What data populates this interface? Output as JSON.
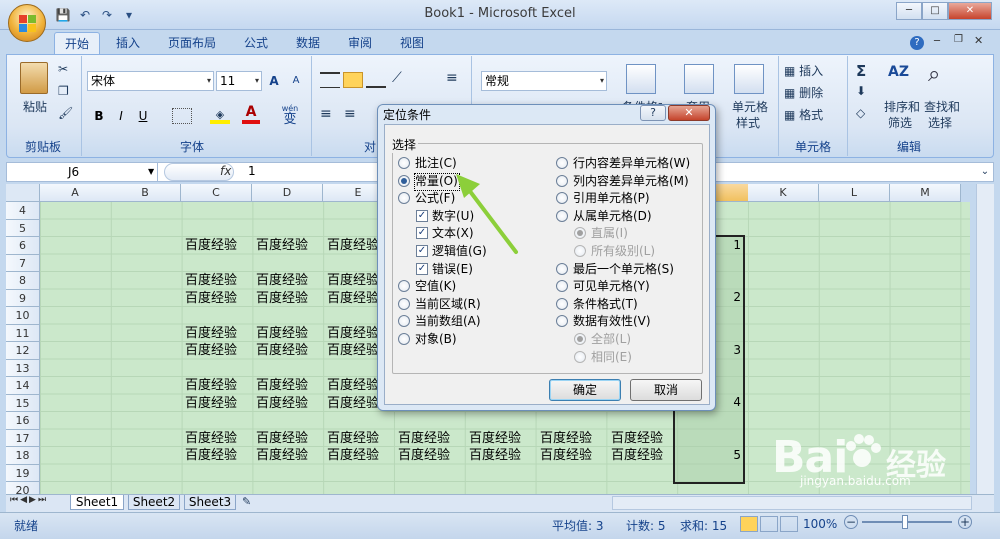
{
  "window": {
    "title": "Book1 - Microsoft Excel",
    "minimize": "─",
    "restore": "□",
    "close": "✕"
  },
  "qat": [
    "💾",
    "↶",
    "↷",
    "▾"
  ],
  "ribbon_tabs": [
    "开始",
    "插入",
    "页面布局",
    "公式",
    "数据",
    "审阅",
    "视图"
  ],
  "ribbon": {
    "clipboard": {
      "paste": "粘贴",
      "label": "剪贴板"
    },
    "font": {
      "name": "宋体",
      "size": "11",
      "grow": "A",
      "shrink": "A",
      "bold": "B",
      "italic": "I",
      "underline": "U",
      "wen": "wén",
      "wen2": "变",
      "label": "字体"
    },
    "alignment": {
      "label": "对齐方式"
    },
    "number": {
      "format": "常规"
    },
    "styles": {
      "cond": "条件格式",
      "table": "套用"
    },
    "cells": {
      "insert": "插入",
      "delete": "删除",
      "format": "格式",
      "label": "单元格",
      "cellstyle": "单元格",
      "cellstyle2": "样式"
    },
    "editing": {
      "sum": "Σ",
      "sort": "排序和",
      "sort2": "筛选",
      "find": "查找和",
      "find2": "选择",
      "label": "编辑"
    }
  },
  "formula_bar": {
    "name_box": "J6",
    "fx": "fx",
    "value": "1"
  },
  "columns": [
    "A",
    "B",
    "C",
    "D",
    "E",
    "F",
    "G",
    "H",
    "I",
    "J",
    "K",
    "L",
    "M"
  ],
  "rows": [
    "4",
    "5",
    "6",
    "7",
    "8",
    "9",
    "10",
    "11",
    "12",
    "13",
    "14",
    "15",
    "16",
    "17",
    "18",
    "19",
    "20"
  ],
  "cell_text": "百度经验",
  "j_values": [
    "1",
    "2",
    "3",
    "4",
    "5"
  ],
  "sheets": [
    "Sheet1",
    "Sheet2",
    "Sheet3"
  ],
  "status": {
    "ready": "就绪",
    "average": "平均值: 3",
    "count": "计数: 5",
    "sum": "求和: 15",
    "zoom": "100%"
  },
  "dialog": {
    "title": "定位条件",
    "help": "?",
    "close": "✕",
    "group": "选择",
    "left": [
      {
        "label": "批注(C)",
        "type": "radio",
        "checked": false
      },
      {
        "label": "常量(O)",
        "type": "radio",
        "checked": true
      },
      {
        "label": "公式(F)",
        "type": "radio",
        "checked": false
      },
      {
        "label": "数字(U)",
        "type": "check",
        "checked": true
      },
      {
        "label": "文本(X)",
        "type": "check",
        "checked": true
      },
      {
        "label": "逻辑值(G)",
        "type": "check",
        "checked": true
      },
      {
        "label": "错误(E)",
        "type": "check",
        "checked": true
      },
      {
        "label": "空值(K)",
        "type": "radio",
        "checked": false
      },
      {
        "label": "当前区域(R)",
        "type": "radio",
        "checked": false
      },
      {
        "label": "当前数组(A)",
        "type": "radio",
        "checked": false
      },
      {
        "label": "对象(B)",
        "type": "radio",
        "checked": false
      }
    ],
    "right": [
      {
        "label": "行内容差异单元格(W)",
        "type": "radio",
        "checked": false
      },
      {
        "label": "列内容差异单元格(M)",
        "type": "radio",
        "checked": false
      },
      {
        "label": "引用单元格(P)",
        "type": "radio",
        "checked": false
      },
      {
        "label": "从属单元格(D)",
        "type": "radio",
        "checked": false
      },
      {
        "label": "直属(I)",
        "type": "radio",
        "checked": true,
        "disabled": true
      },
      {
        "label": "所有级别(L)",
        "type": "radio",
        "checked": false,
        "disabled": true
      },
      {
        "label": "最后一个单元格(S)",
        "type": "radio",
        "checked": false
      },
      {
        "label": "可见单元格(Y)",
        "type": "radio",
        "checked": false
      },
      {
        "label": "条件格式(T)",
        "type": "radio",
        "checked": false
      },
      {
        "label": "数据有效性(V)",
        "type": "radio",
        "checked": false
      },
      {
        "label": "全部(L)",
        "type": "radio",
        "checked": true,
        "disabled": true
      },
      {
        "label": "相同(E)",
        "type": "radio",
        "checked": false,
        "disabled": true
      }
    ],
    "ok": "确定",
    "cancel": "取消"
  },
  "watermark": {
    "brand": "Bai",
    "brand2": "经验",
    "url": "jingyan.baidu.com"
  },
  "colors": {
    "grid_bg": "#cbe8cb",
    "ribbon_bg": "#dbe6f4",
    "accent": "#15428b",
    "arrow": "#8ccf3a"
  }
}
